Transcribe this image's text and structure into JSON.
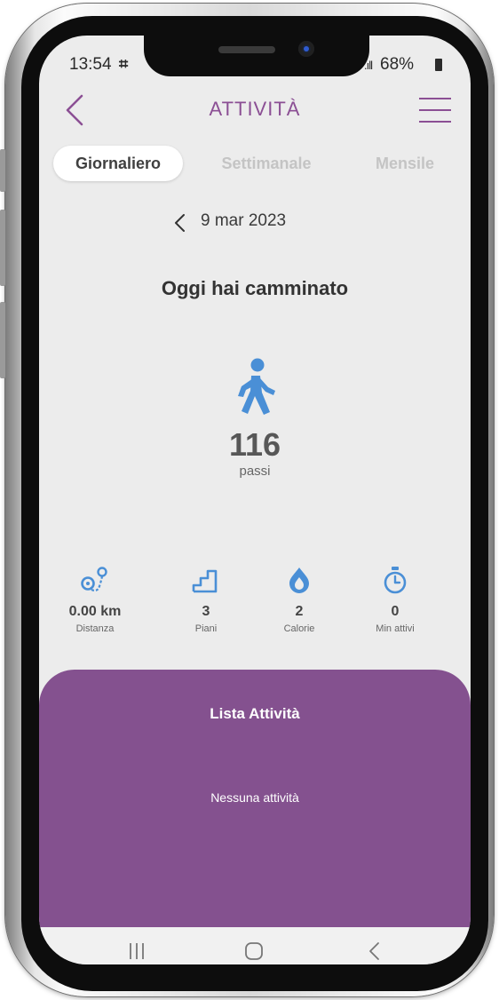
{
  "status_bar": {
    "time": "13:54",
    "notification_glyph": "⌗",
    "signal": ".ıll",
    "battery": "68%"
  },
  "header": {
    "title": "ATTIVITÀ"
  },
  "tabs": [
    {
      "label": "Giornaliero",
      "active": true
    },
    {
      "label": "Settimanale",
      "active": false
    },
    {
      "label": "Mensile",
      "active": false
    }
  ],
  "date_nav": {
    "date": "9 mar 2023"
  },
  "summary": {
    "heading": "Oggi hai camminato",
    "steps": "116",
    "steps_unit": "passi"
  },
  "stats": [
    {
      "icon": "distance-pin-icon",
      "value": "0.00 km",
      "label": "Distanza"
    },
    {
      "icon": "stairs-icon",
      "value": "3",
      "label": "Piani"
    },
    {
      "icon": "flame-icon",
      "value": "2",
      "label": "Calorie"
    },
    {
      "icon": "stopwatch-icon",
      "value": "0",
      "label": "Min attivi"
    }
  ],
  "activity_list": {
    "title": "Lista Attività",
    "empty_text": "Nessuna attività"
  },
  "colors": {
    "accent": "#8b4f94",
    "panel": "#84518f",
    "icon_blue": "#4a8fd6",
    "screen_bg": "#ececec"
  }
}
